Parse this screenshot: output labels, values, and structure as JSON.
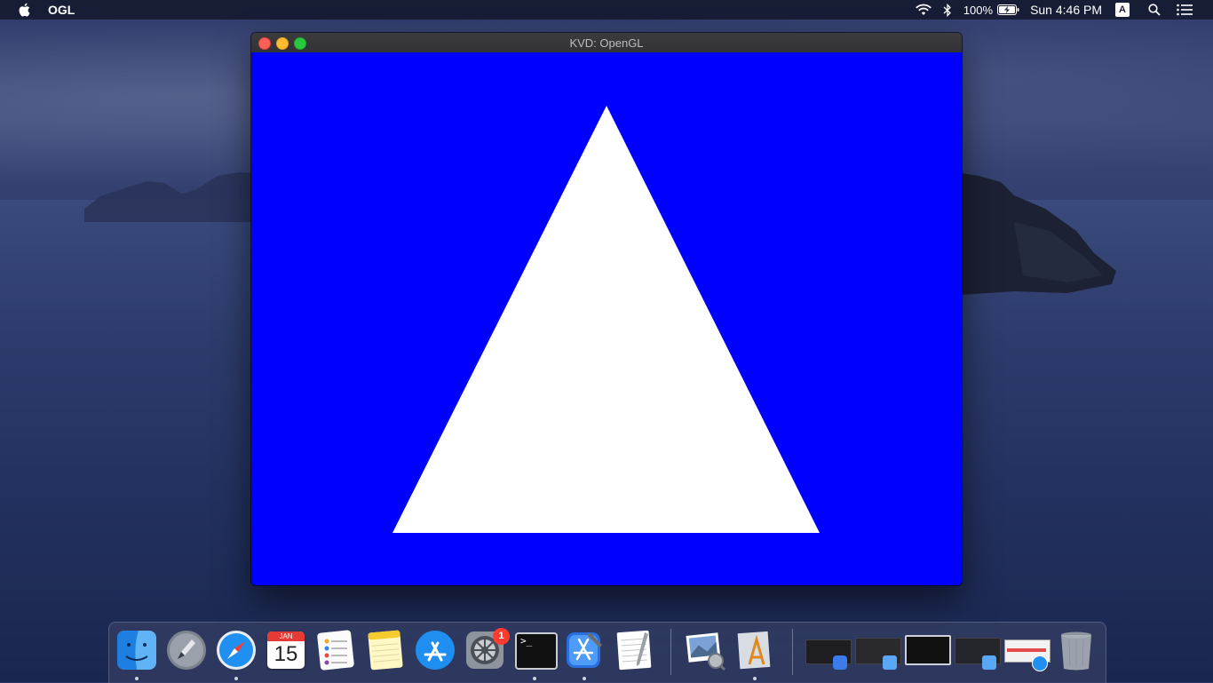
{
  "menubar": {
    "app_name": "OGL",
    "battery_percent": "100%",
    "clock": "Sun 4:46 PM",
    "input_source": "A"
  },
  "window": {
    "title": "KVD: OpenGL",
    "canvas_color": "#0000ff",
    "shape_color": "#ffffff"
  },
  "dock": {
    "calendar_month": "JAN",
    "calendar_day": "15",
    "system_prefs_badge": "1",
    "terminal_prompt": ">_",
    "apps": [
      "finder-icon",
      "launchpad-icon",
      "safari-icon",
      "calendar-icon",
      "reminders-icon",
      "notes-icon",
      "app-store-icon",
      "system-preferences-icon",
      "terminal-icon",
      "xcode-icon",
      "textedit-icon",
      "preview-icon",
      "instruments-icon",
      "trash-icon"
    ]
  }
}
